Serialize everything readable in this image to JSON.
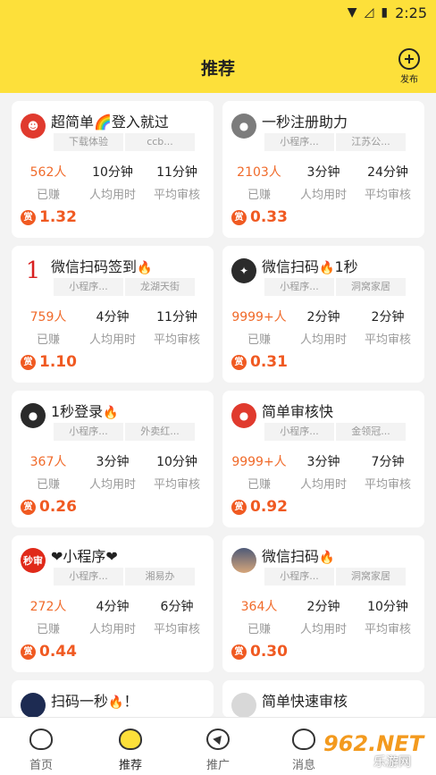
{
  "status_bar": {
    "time": "2:25",
    "icons": [
      "wifi-icon",
      "signal-off-icon",
      "battery-charging-icon"
    ]
  },
  "header": {
    "title": "推荐",
    "publish_label": "发布"
  },
  "stat_labels": {
    "earned": "已赚",
    "avg_time": "人均用时",
    "avg_review": "平均审核"
  },
  "reward_icon": "赏",
  "cards": [
    {
      "name": "超简单🌈登入就过",
      "flame": false,
      "avatar": "cartoon-avatar",
      "tag1": "下载体验",
      "tag2": "ccb...",
      "earned": "562人",
      "avg_time": "10分钟",
      "avg_review": "11分钟",
      "reward": "1.32"
    },
    {
      "name": "一秒注册助力",
      "flame": false,
      "avatar": "user-avatar",
      "tag1": "小程序...",
      "tag2": "江苏公...",
      "earned": "2103人",
      "avg_time": "3分钟",
      "avg_review": "24分钟",
      "reward": "0.33"
    },
    {
      "name": "微信扫码签到",
      "flame": true,
      "avatar": "number-avatar",
      "avatar_text": "1",
      "tag1": "小程序...",
      "tag2": "龙湖天街",
      "earned": "759人",
      "avg_time": "4分钟",
      "avg_review": "11分钟",
      "reward": "1.10"
    },
    {
      "name": "微信扫码",
      "name_suffix": "1秒",
      "flame": true,
      "avatar": "logo-avatar",
      "tag1": "小程序...",
      "tag2": "洞窝家居",
      "earned": "9999+人",
      "avg_time": "2分钟",
      "avg_review": "2分钟",
      "reward": "0.31"
    },
    {
      "name": "1秒登录",
      "flame": true,
      "avatar": "user-avatar",
      "tag1": "小程序...",
      "tag2": "外卖红...",
      "earned": "367人",
      "avg_time": "3分钟",
      "avg_review": "10分钟",
      "reward": "0.26"
    },
    {
      "name": "简单审核快",
      "flame": false,
      "avatar": "user-avatar",
      "tag1": "小程序...",
      "tag2": "金领冠...",
      "earned": "9999+人",
      "avg_time": "3分钟",
      "avg_review": "7分钟",
      "reward": "0.92"
    },
    {
      "name": "❤小程序❤",
      "flame": false,
      "avatar": "text-avatar",
      "avatar_text": "秒审",
      "tag1": "小程序...",
      "tag2": "湘易办",
      "earned": "272人",
      "avg_time": "4分钟",
      "avg_review": "6分钟",
      "reward": "0.44"
    },
    {
      "name": "微信扫码",
      "flame": true,
      "avatar": "landscape-avatar",
      "tag1": "小程序...",
      "tag2": "洞窝家居",
      "earned": "364人",
      "avg_time": "2分钟",
      "avg_review": "10分钟",
      "reward": "0.30"
    },
    {
      "name": "扫码一秒",
      "name_suffix": "！",
      "flame": true,
      "avatar": "user-avatar",
      "partial": true
    },
    {
      "name": "简单快速审核",
      "flame": false,
      "avatar": "user-avatar",
      "partial": true
    }
  ],
  "tabbar": [
    {
      "label": "首页",
      "icon": "home-icon",
      "active": false
    },
    {
      "label": "推荐",
      "icon": "recommend-icon",
      "active": true
    },
    {
      "label": "推广",
      "icon": "promote-icon",
      "active": false
    },
    {
      "label": "消息",
      "icon": "message-icon",
      "active": false
    }
  ],
  "watermark": {
    "brand": "962.NET",
    "site": "乐游网"
  }
}
